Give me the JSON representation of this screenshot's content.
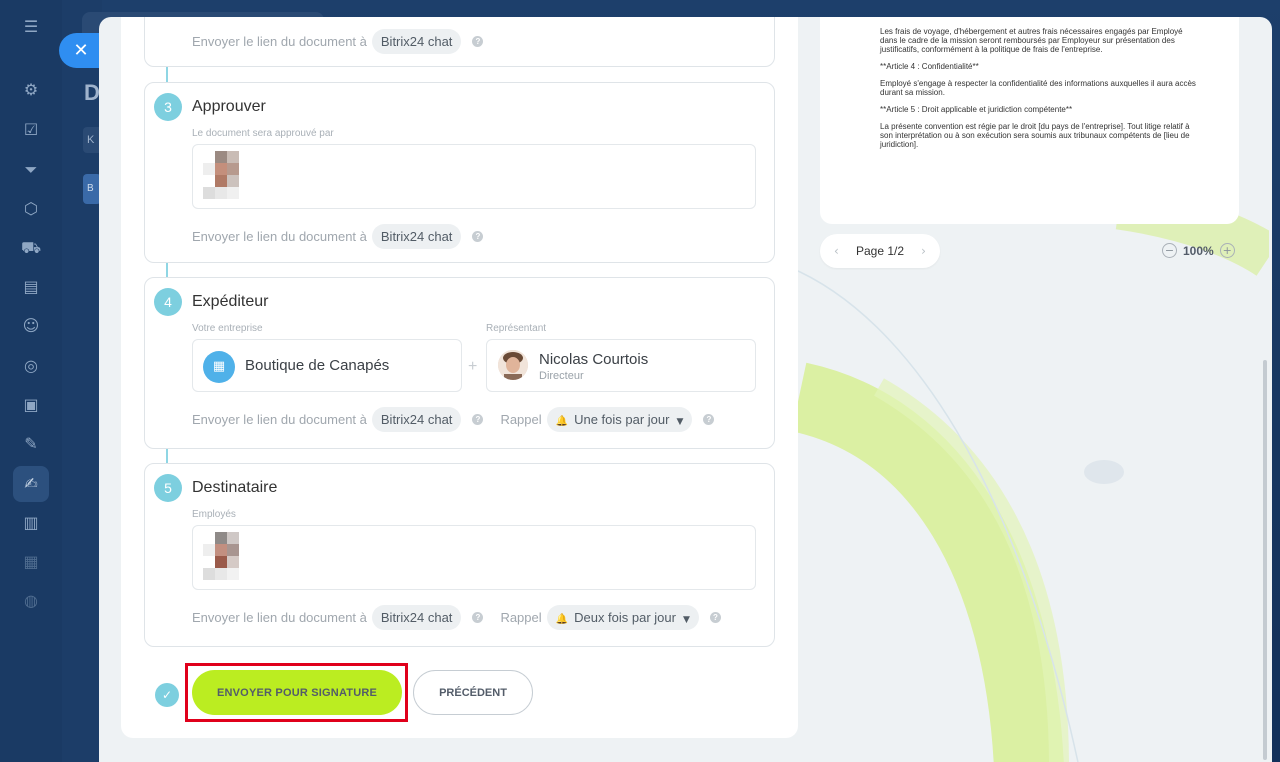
{
  "app": {
    "close_label": "✕",
    "bg_title_letter": "D",
    "bg_chip_k": "K",
    "bg_chip_b": "B"
  },
  "steps": {
    "top_partial": {
      "send_link_label": "Envoyer le lien du document à",
      "channel": "Bitrix24 chat"
    },
    "approve": {
      "number": "3",
      "title": "Approuver",
      "field_label": "Le document sera approuvé par",
      "send_link_label": "Envoyer le lien du document à",
      "channel": "Bitrix24 chat"
    },
    "sender": {
      "number": "4",
      "title": "Expéditeur",
      "company_label": "Votre entreprise",
      "company_name": "Boutique de Canapés",
      "plus": "+",
      "rep_label": "Représentant",
      "rep_name": "Nicolas Courtois",
      "rep_role": "Directeur",
      "send_link_label": "Envoyer le lien du document à",
      "channel": "Bitrix24 chat",
      "reminder_label": "Rappel",
      "reminder_value": "Une fois par jour"
    },
    "recipient": {
      "number": "5",
      "title": "Destinataire",
      "field_label": "Employés",
      "send_link_label": "Envoyer le lien du document à",
      "channel": "Bitrix24 chat",
      "reminder_label": "Rappel",
      "reminder_value": "Deux fois par jour"
    }
  },
  "actions": {
    "send_label": "ENVOYER POUR SIGNATURE",
    "prev_label": "PRÉCÉDENT",
    "check": "✓"
  },
  "preview": {
    "paragraphs": [
      "Les frais de voyage, d'hébergement et autres frais nécessaires engagés par Employé dans le cadre de la mission seront remboursés par Employeur sur présentation des justificatifs, conformément à la politique de frais de l'entreprise.",
      "**Article 4 : Confidentialité**",
      "Employé s'engage à respecter la confidentialité des informations auxquelles il aura accès durant sa mission.",
      "**Article 5 : Droit applicable et juridiction compétente**",
      "La présente convention est régie par le droit [du pays de l'entreprise]. Tout litige relatif à son interprétation ou à son exécution sera soumis aux tribunaux compétents de [lieu de juridiction]."
    ],
    "page_label": "Page 1/2",
    "prev_arrow": "‹",
    "next_arrow": "›",
    "zoom_value": "100%",
    "zoom_out": "−",
    "zoom_in": "+"
  },
  "icons": {
    "help": "?",
    "bell": "🔔",
    "caret": "▼",
    "org": "▦"
  },
  "colors": {
    "accent_green": "#bbed21",
    "timeline_teal": "#7dcfdf",
    "highlight_red": "#e0001b",
    "close_blue": "#2f8ef1"
  }
}
